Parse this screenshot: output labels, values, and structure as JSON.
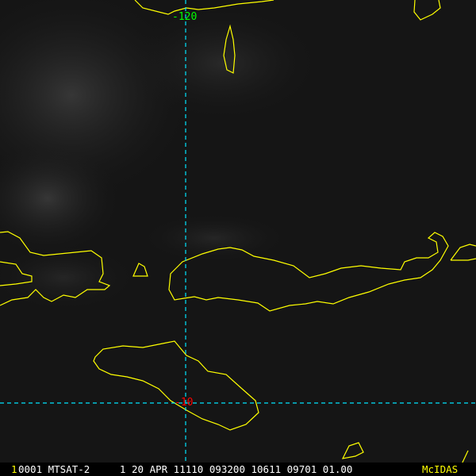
{
  "grid_labels": {
    "longitude": "-120",
    "latitude": "-10"
  },
  "status_bar": {
    "frame_number": "1",
    "fields": "0001 MTSAT-2     1 20 APR 11110 093200 10611 09701 01.00",
    "brand": "McIDAS"
  },
  "colors": {
    "coastline": "#ffff00",
    "gridline": "#00e5ff",
    "lon_label": "#00ff00",
    "lat_label": "#ff0000",
    "brand": "#ffff00"
  }
}
